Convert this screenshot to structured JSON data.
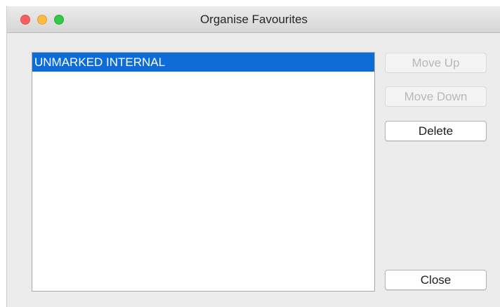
{
  "window": {
    "title": "Organise Favourites"
  },
  "favourites": {
    "items": [
      {
        "label": "UNMARKED INTERNAL",
        "selected": true
      }
    ]
  },
  "buttons": {
    "move_up": {
      "label": "Move Up",
      "enabled": false
    },
    "move_down": {
      "label": "Move Down",
      "enabled": false
    },
    "delete": {
      "label": "Delete",
      "enabled": true
    },
    "close": {
      "label": "Close",
      "enabled": true
    }
  },
  "colors": {
    "selection": "#0e6cd6",
    "traffic_close": "#fc605c",
    "traffic_minimize": "#fdbc40",
    "traffic_maximize": "#34c84a"
  }
}
